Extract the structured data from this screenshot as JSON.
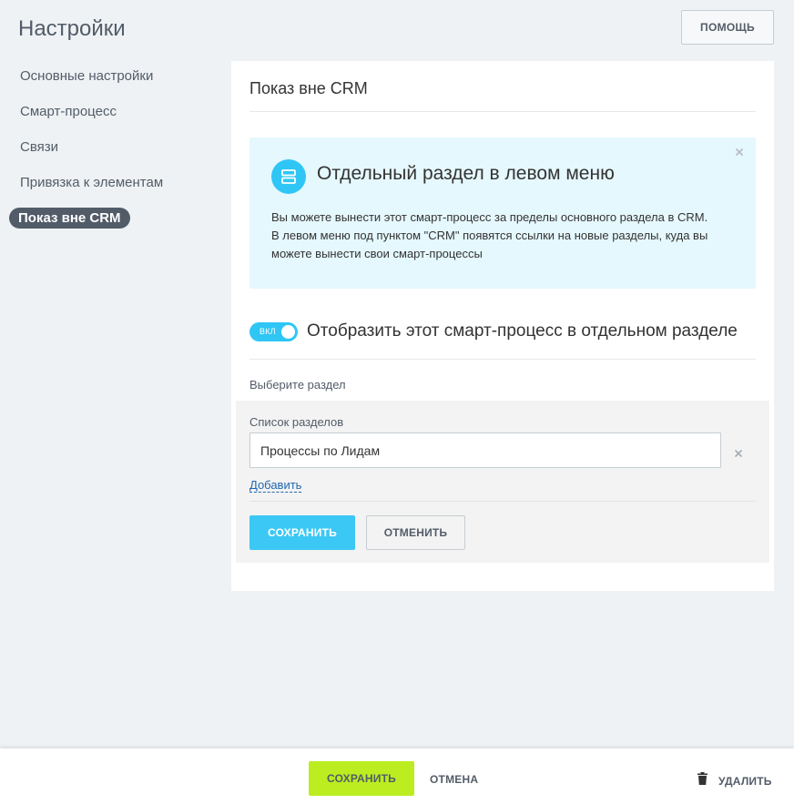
{
  "header": {
    "title": "Настройки",
    "help_label": "ПОМОЩЬ"
  },
  "sidebar": {
    "items": [
      {
        "label": "Основные настройки",
        "active": false
      },
      {
        "label": "Смарт-процесс",
        "active": false
      },
      {
        "label": "Связи",
        "active": false
      },
      {
        "label": "Привязка к элементам",
        "active": false
      },
      {
        "label": "Показ вне CRM",
        "active": true
      }
    ]
  },
  "card": {
    "title": "Показ вне CRM",
    "info": {
      "icon": "sections-icon",
      "title": "Отдельный раздел в левом меню",
      "text_lines": [
        "Вы можете вынести этот смарт-процесс за пределы основного раздела в CRM.",
        "В левом меню под пунктом \"CRM\" появятся ссылки на новые разделы, куда вы",
        "можете вынести свои смарт-процессы"
      ]
    },
    "toggle": {
      "label": "ВКЛ",
      "text": "Отобразить этот смарт-процесс в отдельном разделе"
    },
    "choose_label": "Выберите раздел",
    "panel": {
      "list_label": "Список разделов",
      "input_value": "Процессы по Лидам",
      "add_label": "Добавить",
      "save_label": "СОХРАНИТЬ",
      "cancel_label": "ОТМЕНИТЬ"
    }
  },
  "footer": {
    "save_label": "СОХРАНИТЬ",
    "cancel_label": "ОТМЕНА",
    "delete_label": "УДАЛИТЬ"
  },
  "colors": {
    "accent": "#2fc6f6",
    "primary_button": "#3bc8f5",
    "footer_save": "#bbed21",
    "sidebar_active": "#525c69",
    "info_bg": "#e5f8fd",
    "link": "#2067b0"
  }
}
